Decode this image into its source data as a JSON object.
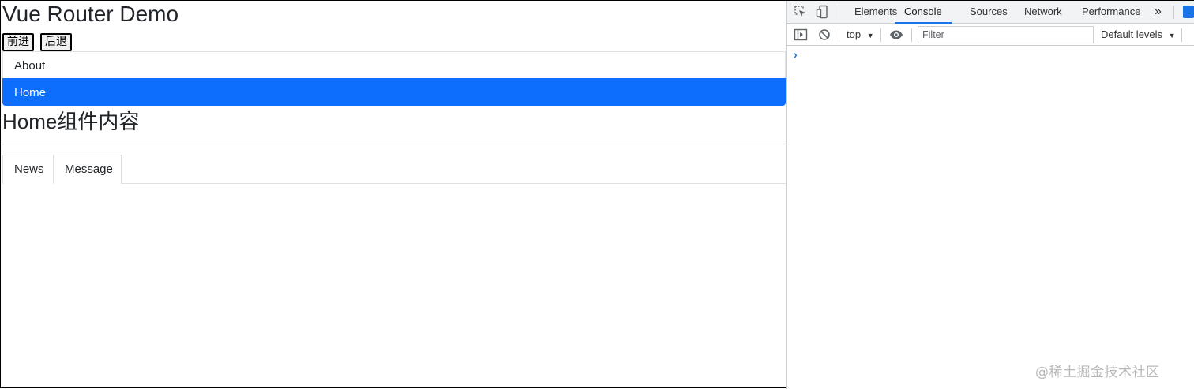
{
  "app": {
    "title": "Vue Router Demo",
    "forward_label": "前进",
    "back_label": "后退",
    "list": [
      {
        "label": "About",
        "active": false
      },
      {
        "label": "Home",
        "active": true
      }
    ],
    "content_title": "Home组件内容",
    "tabs": [
      "News",
      "Message"
    ]
  },
  "watermark": "@稀土掘金技术社区",
  "devtools": {
    "tabs": [
      "Elements",
      "Console",
      "Sources",
      "Network",
      "Performance"
    ],
    "active_tab": "Console",
    "more_tabs": "»",
    "context": "top",
    "filter_placeholder": "Filter",
    "levels": "Default levels",
    "prompt": "›",
    "colors": {
      "accent": "#1a73e8",
      "active_item": "#0d6efd"
    }
  }
}
